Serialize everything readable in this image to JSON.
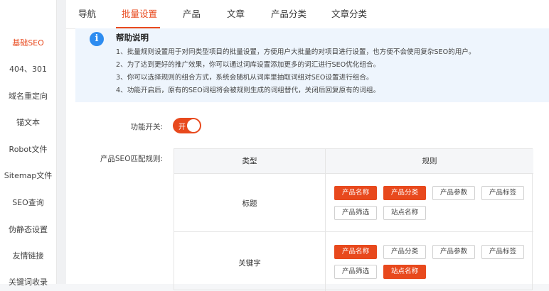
{
  "sidebar": {
    "items": [
      {
        "label": "基础SEO",
        "active": true
      },
      {
        "label": "404、301",
        "active": false
      },
      {
        "label": "域名重定向",
        "active": false
      },
      {
        "label": "锚文本",
        "active": false
      },
      {
        "label": "Robot文件",
        "active": false
      },
      {
        "label": "Sitemap文件",
        "active": false
      },
      {
        "label": "SEO查询",
        "active": false
      },
      {
        "label": "伪静态设置",
        "active": false
      },
      {
        "label": "友情链接",
        "active": false
      },
      {
        "label": "关键词收录",
        "active": false
      }
    ]
  },
  "tabs": [
    {
      "label": "导航",
      "active": false
    },
    {
      "label": "批量设置",
      "active": true
    },
    {
      "label": "产品",
      "active": false
    },
    {
      "label": "文章",
      "active": false
    },
    {
      "label": "产品分类",
      "active": false
    },
    {
      "label": "文章分类",
      "active": false
    }
  ],
  "help": {
    "icon": "info-icon",
    "icon_glyph": "i",
    "title": "帮助说明",
    "lines": [
      "1、批量规则设置用于对同类型项目的批量设置，方便用户大批量的对项目进行设置，也方便不会使用复杂SEO的用户。",
      "2、为了达到更好的推广效果，你可以通过词库设置添加更多的词汇进行SEO优化组合。",
      "3、你可以选择规则的组合方式，系统会随机从词库里抽取词组对SEO设置进行组合。",
      "4、功能开启后，原有的SEO词组将会被规则生成的词组替代，关闭后回复原有的词组。"
    ]
  },
  "form": {
    "switch_label": "功能开关:",
    "switch_text": "开",
    "switch_on": true,
    "rule_label": "产品SEO匹配规则:"
  },
  "table": {
    "headers": [
      "类型",
      "规则"
    ],
    "rows": [
      {
        "type": "标题",
        "tags": [
          {
            "label": "产品名称",
            "selected": true
          },
          {
            "label": "产品分类",
            "selected": true
          },
          {
            "label": "产品参数",
            "selected": false
          },
          {
            "label": "产品标签",
            "selected": false
          },
          {
            "label": "产品筛选",
            "selected": false
          },
          {
            "label": "站点名称",
            "selected": false
          }
        ]
      },
      {
        "type": "关键字",
        "tags": [
          {
            "label": "产品名称",
            "selected": true
          },
          {
            "label": "产品分类",
            "selected": false
          },
          {
            "label": "产品参数",
            "selected": false
          },
          {
            "label": "产品标签",
            "selected": false
          },
          {
            "label": "产品筛选",
            "selected": false
          },
          {
            "label": "站点名称",
            "selected": true
          }
        ]
      }
    ]
  },
  "colors": {
    "accent": "#e8491d",
    "info": "#2d8cf0",
    "help_bg": "#eef5fd"
  }
}
